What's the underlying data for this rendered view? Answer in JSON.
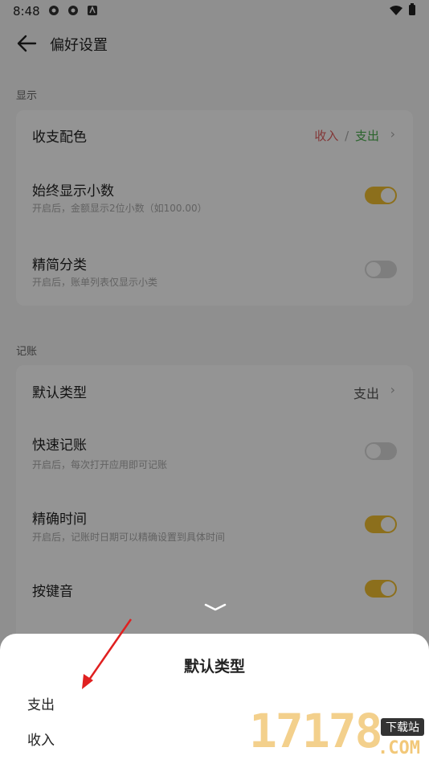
{
  "status_bar": {
    "time": "8:48"
  },
  "header": {
    "title": "偏好设置"
  },
  "sections": [
    {
      "label": "显示",
      "rows": [
        {
          "label": "收支配色",
          "income": "收入",
          "separator": "/",
          "expense": "支出"
        },
        {
          "label": "始终显示小数",
          "desc": "开启后，金额显示2位小数（如100.00）",
          "toggle": "on"
        },
        {
          "label": "精简分类",
          "desc": "开启后，账单列表仅显示小类",
          "toggle": "off"
        }
      ]
    },
    {
      "label": "记账",
      "rows": [
        {
          "label": "默认类型",
          "value": "支出"
        },
        {
          "label": "快速记账",
          "desc": "开启后，每次打开应用即可记账",
          "toggle": "off"
        },
        {
          "label": "精确时间",
          "desc": "开启后，记账时日期可以精确设置到具体时间",
          "toggle": "on"
        },
        {
          "label": "按键音",
          "toggle": "on"
        }
      ]
    }
  ],
  "sheet": {
    "title": "默认类型",
    "options": [
      "支出",
      "收入"
    ]
  },
  "watermark": {
    "number": "17178",
    "tag": "下载站",
    "domain": ".COM"
  },
  "colors": {
    "accent": "#f2c031",
    "income": "#e26060",
    "expense": "#4caf50"
  }
}
